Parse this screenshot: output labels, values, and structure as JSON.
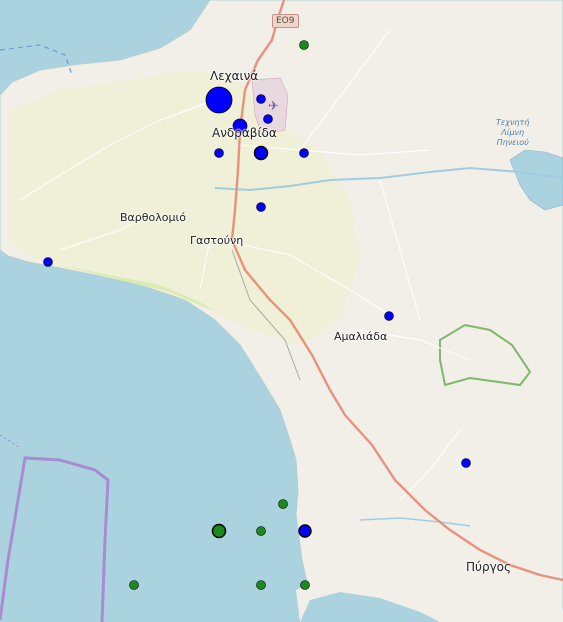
{
  "map": {
    "road_shield": "EO9",
    "places": {
      "lechaina": "Λεχαινά",
      "andravida": "Ανδραβίδα",
      "vartholomio": "Βαρθολομιό",
      "gastouni": "Γαστούνη",
      "amaliada": "Αμαλιάδα",
      "pyrgos": "Πύργος"
    },
    "lake_label": [
      "Τεχνητή",
      "Λίμνη",
      "Πηνειού"
    ],
    "colors": {
      "sea": "#aad3df",
      "land": "#f2efe9",
      "farmland": "#eef0d5",
      "beach": "#d9ecb3",
      "primary_road": "#e8927c",
      "boundary": "#a87fd0",
      "marker_blue": "#0000ff",
      "marker_green": "#1a8a1a"
    }
  }
}
